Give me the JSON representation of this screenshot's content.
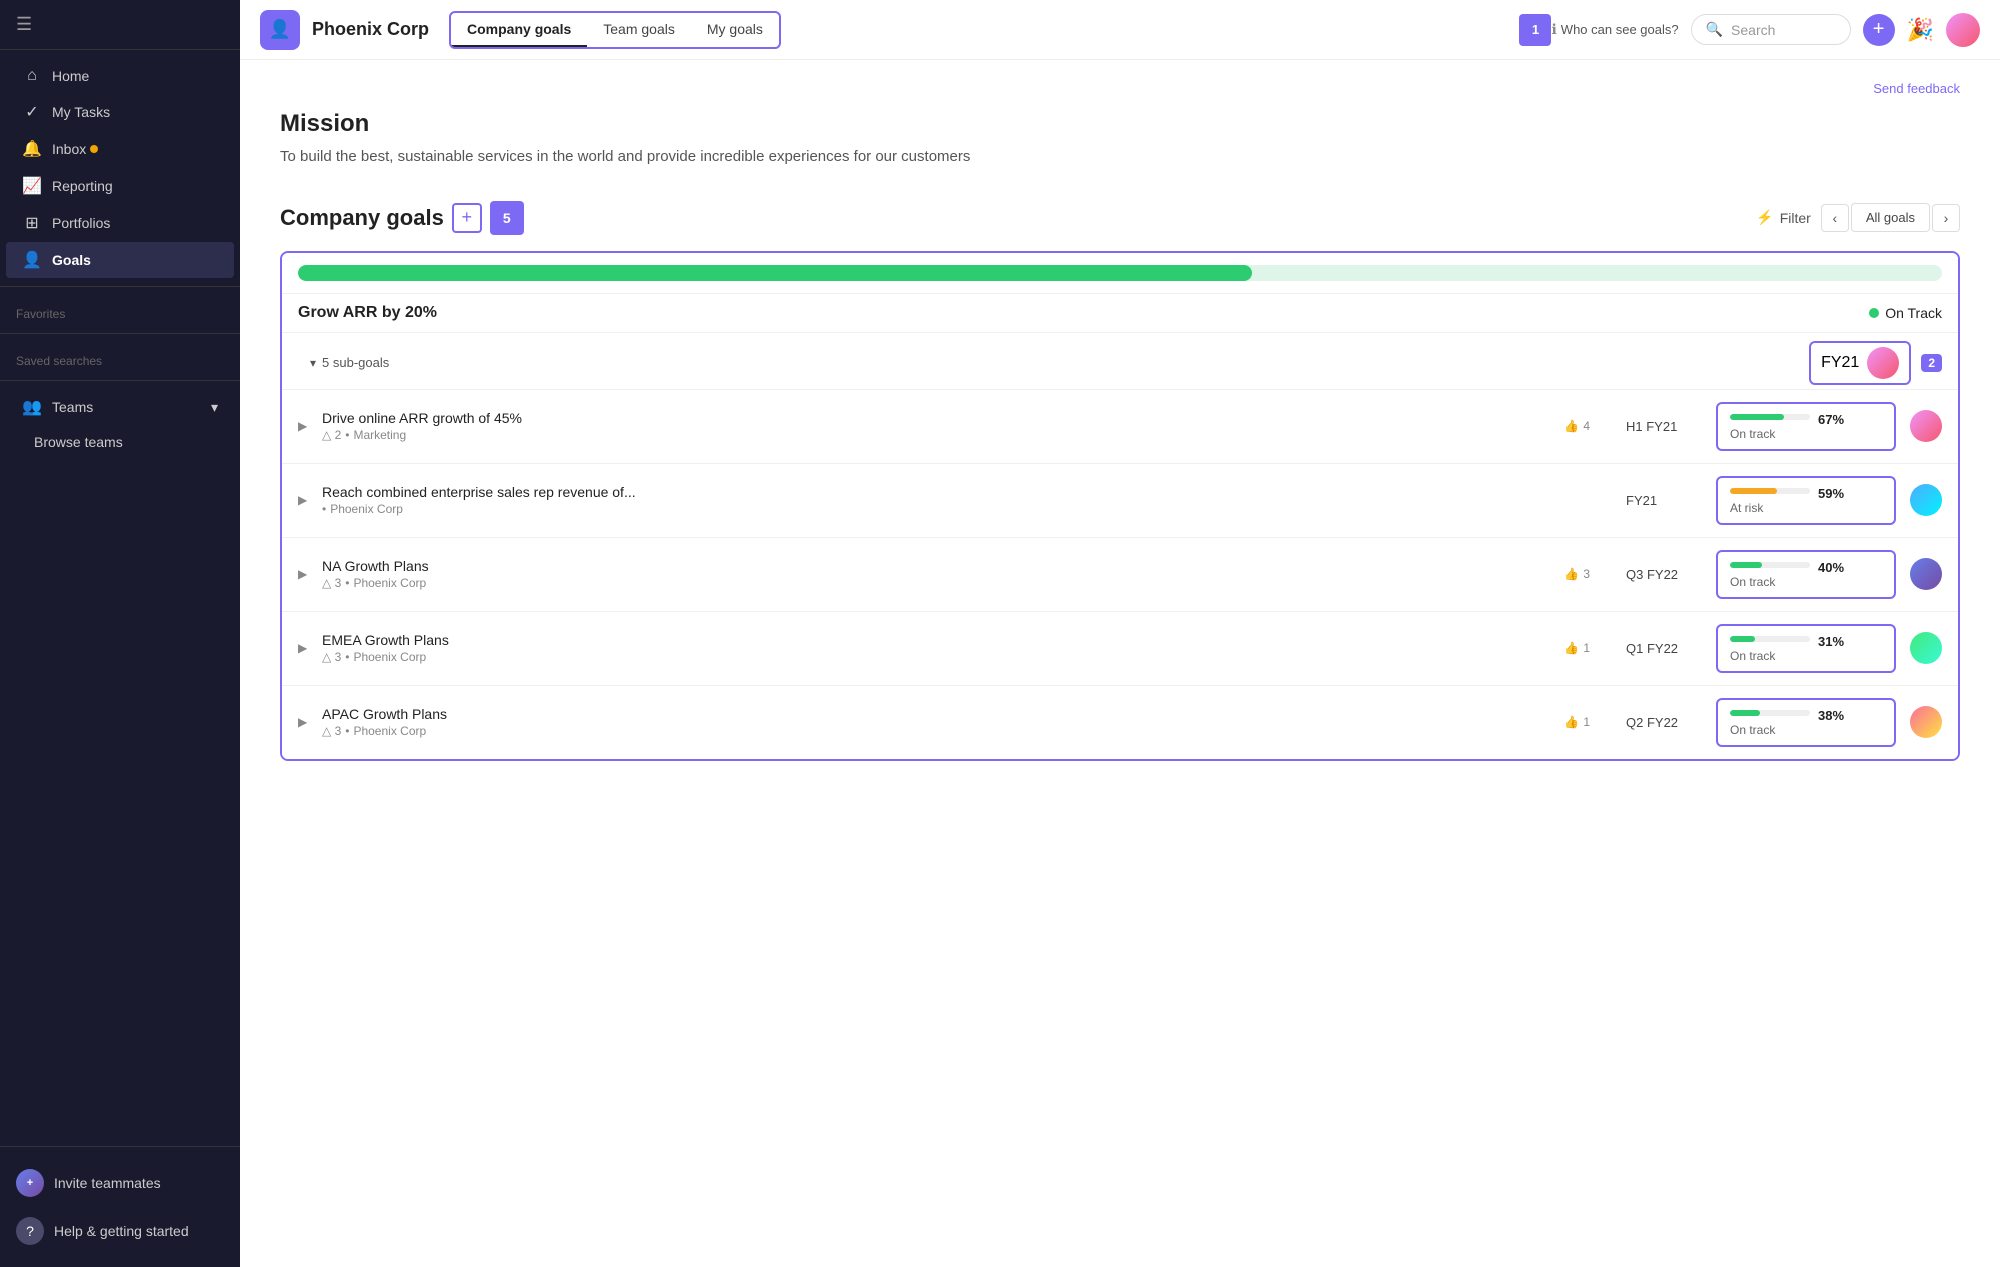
{
  "sidebar": {
    "toggle_icon": "☰",
    "nav_items": [
      {
        "id": "home",
        "icon": "○",
        "label": "Home",
        "active": false
      },
      {
        "id": "my-tasks",
        "icon": "✓",
        "label": "My Tasks",
        "active": false
      },
      {
        "id": "inbox",
        "icon": "🔔",
        "label": "Inbox",
        "active": false,
        "badge": true
      },
      {
        "id": "reporting",
        "icon": "📈",
        "label": "Reporting",
        "active": false
      },
      {
        "id": "portfolios",
        "icon": "⊞",
        "label": "Portfolios",
        "active": false
      },
      {
        "id": "goals",
        "icon": "👤",
        "label": "Goals",
        "active": true
      }
    ],
    "sections": {
      "favorites": "Favorites",
      "saved_searches": "Saved searches",
      "teams": "Teams",
      "browse_teams": "Browse teams"
    },
    "footer": {
      "invite": "Invite teammates",
      "help": "Help & getting started"
    }
  },
  "topbar": {
    "company_avatar": "👤",
    "company_name": "Phoenix Corp",
    "tabs": [
      {
        "id": "company",
        "label": "Company goals",
        "active": true
      },
      {
        "id": "team",
        "label": "Team goals",
        "active": false
      },
      {
        "id": "my",
        "label": "My goals",
        "active": false
      }
    ],
    "tab_number": "1",
    "who_can_see": "Who can see goals?",
    "search_placeholder": "Search",
    "add_icon": "+",
    "feedback_link": "Send feedback"
  },
  "mission": {
    "title": "Mission",
    "text": "To build the best, sustainable services in the world and provide incredible experiences for our customers"
  },
  "goals_section": {
    "title": "Company goals",
    "add_icon": "+",
    "count": "5",
    "count_number": "2",
    "filter_label": "Filter",
    "all_goals_label": "All goals",
    "main_goal": {
      "progress_pct": 58,
      "name": "Grow ARR by 20%",
      "status": "On Track",
      "status_dot_color": "#2ecc71",
      "subgoals_label": "5 sub-goals",
      "period": "FY21",
      "period_badge_number": "2"
    },
    "subgoals": [
      {
        "name": "Drive online ARR growth of 45%",
        "likes": "4",
        "period": "H1 FY21",
        "warnings": "2",
        "tag": "Marketing",
        "progress_pct": 67,
        "progress_color": "#2ecc71",
        "progress_label": "67%",
        "status": "On track",
        "avatar_class": "av1",
        "badge_number": "4"
      },
      {
        "name": "Reach combined enterprise sales rep revenue of...",
        "likes": "",
        "period": "FY21",
        "warnings": "",
        "tag": "Phoenix Corp",
        "progress_pct": 59,
        "progress_color": "#f5a623",
        "progress_label": "59%",
        "status": "At risk",
        "avatar_class": "av2",
        "badge_number": ""
      },
      {
        "name": "NA Growth Plans",
        "likes": "3",
        "period": "Q3 FY22",
        "warnings": "3",
        "tag": "Phoenix Corp",
        "progress_pct": 40,
        "progress_color": "#2ecc71",
        "progress_label": "40%",
        "status": "On track",
        "avatar_class": "av3",
        "badge_number": "3"
      },
      {
        "name": "EMEA Growth Plans",
        "likes": "1",
        "period": "Q1 FY22",
        "warnings": "3",
        "tag": "Phoenix Corp",
        "progress_pct": 31,
        "progress_color": "#2ecc71",
        "progress_label": "31%",
        "status": "On track",
        "avatar_class": "av4",
        "badge_number": "1"
      },
      {
        "name": "APAC Growth Plans",
        "likes": "1",
        "period": "Q2 FY22",
        "warnings": "3",
        "tag": "Phoenix Corp",
        "progress_pct": 38,
        "progress_color": "#2ecc71",
        "progress_label": "38%",
        "status": "On track",
        "avatar_class": "av5",
        "badge_number": "1"
      }
    ]
  }
}
